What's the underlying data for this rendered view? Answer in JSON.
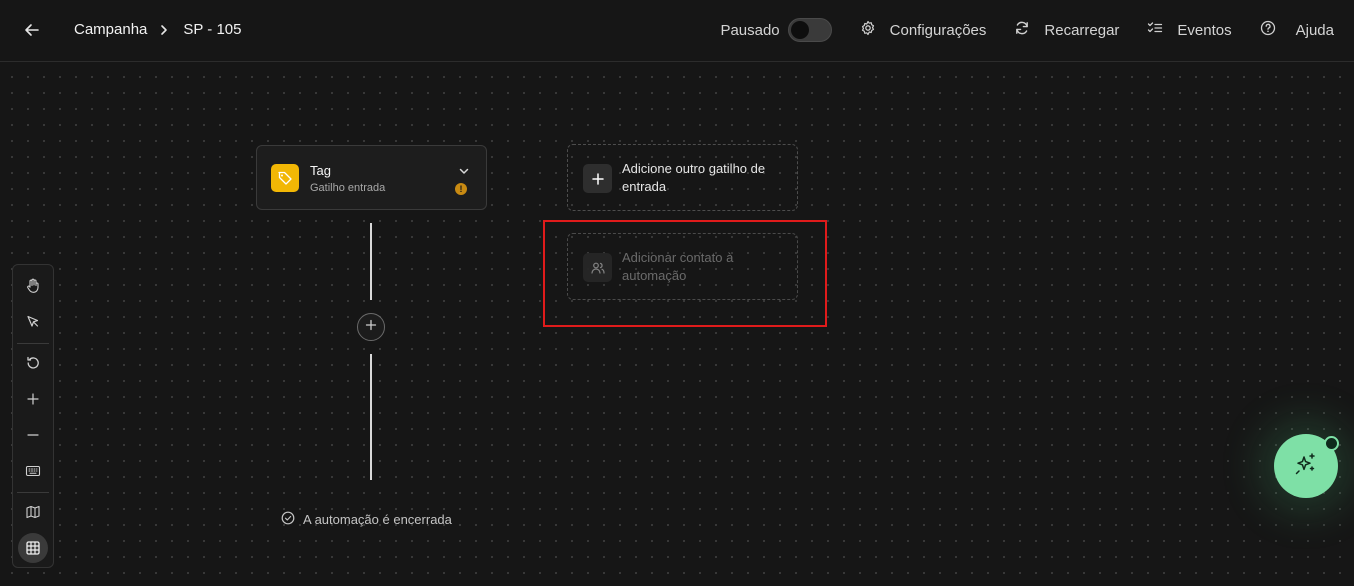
{
  "header": {
    "breadcrumb": [
      "Campanha",
      "SP - 105"
    ],
    "status_label": "Pausado",
    "toggle_on": false,
    "actions": {
      "settings": "Configurações",
      "reload": "Recarregar",
      "events": "Eventos",
      "help": "Ajuda"
    }
  },
  "flow": {
    "trigger": {
      "title": "Tag",
      "subtitle": "Gatilho entrada",
      "warning": "!"
    },
    "add_trigger_label": "Adicione outro gatilho de entrada",
    "add_contact_label": "Adicionar contato à automação",
    "end_note": "A automação é encerrada"
  },
  "colors": {
    "background": "#161616",
    "tag_icon": "#f2b705",
    "highlight": "#e01b1b",
    "fab": "#7ee0a6"
  },
  "icons": {
    "toolbar": [
      "hand-icon",
      "pointer-icon",
      "undo-icon",
      "zoom-in-icon",
      "zoom-out-icon",
      "keyboard-icon",
      "map-icon",
      "grid-icon"
    ]
  }
}
